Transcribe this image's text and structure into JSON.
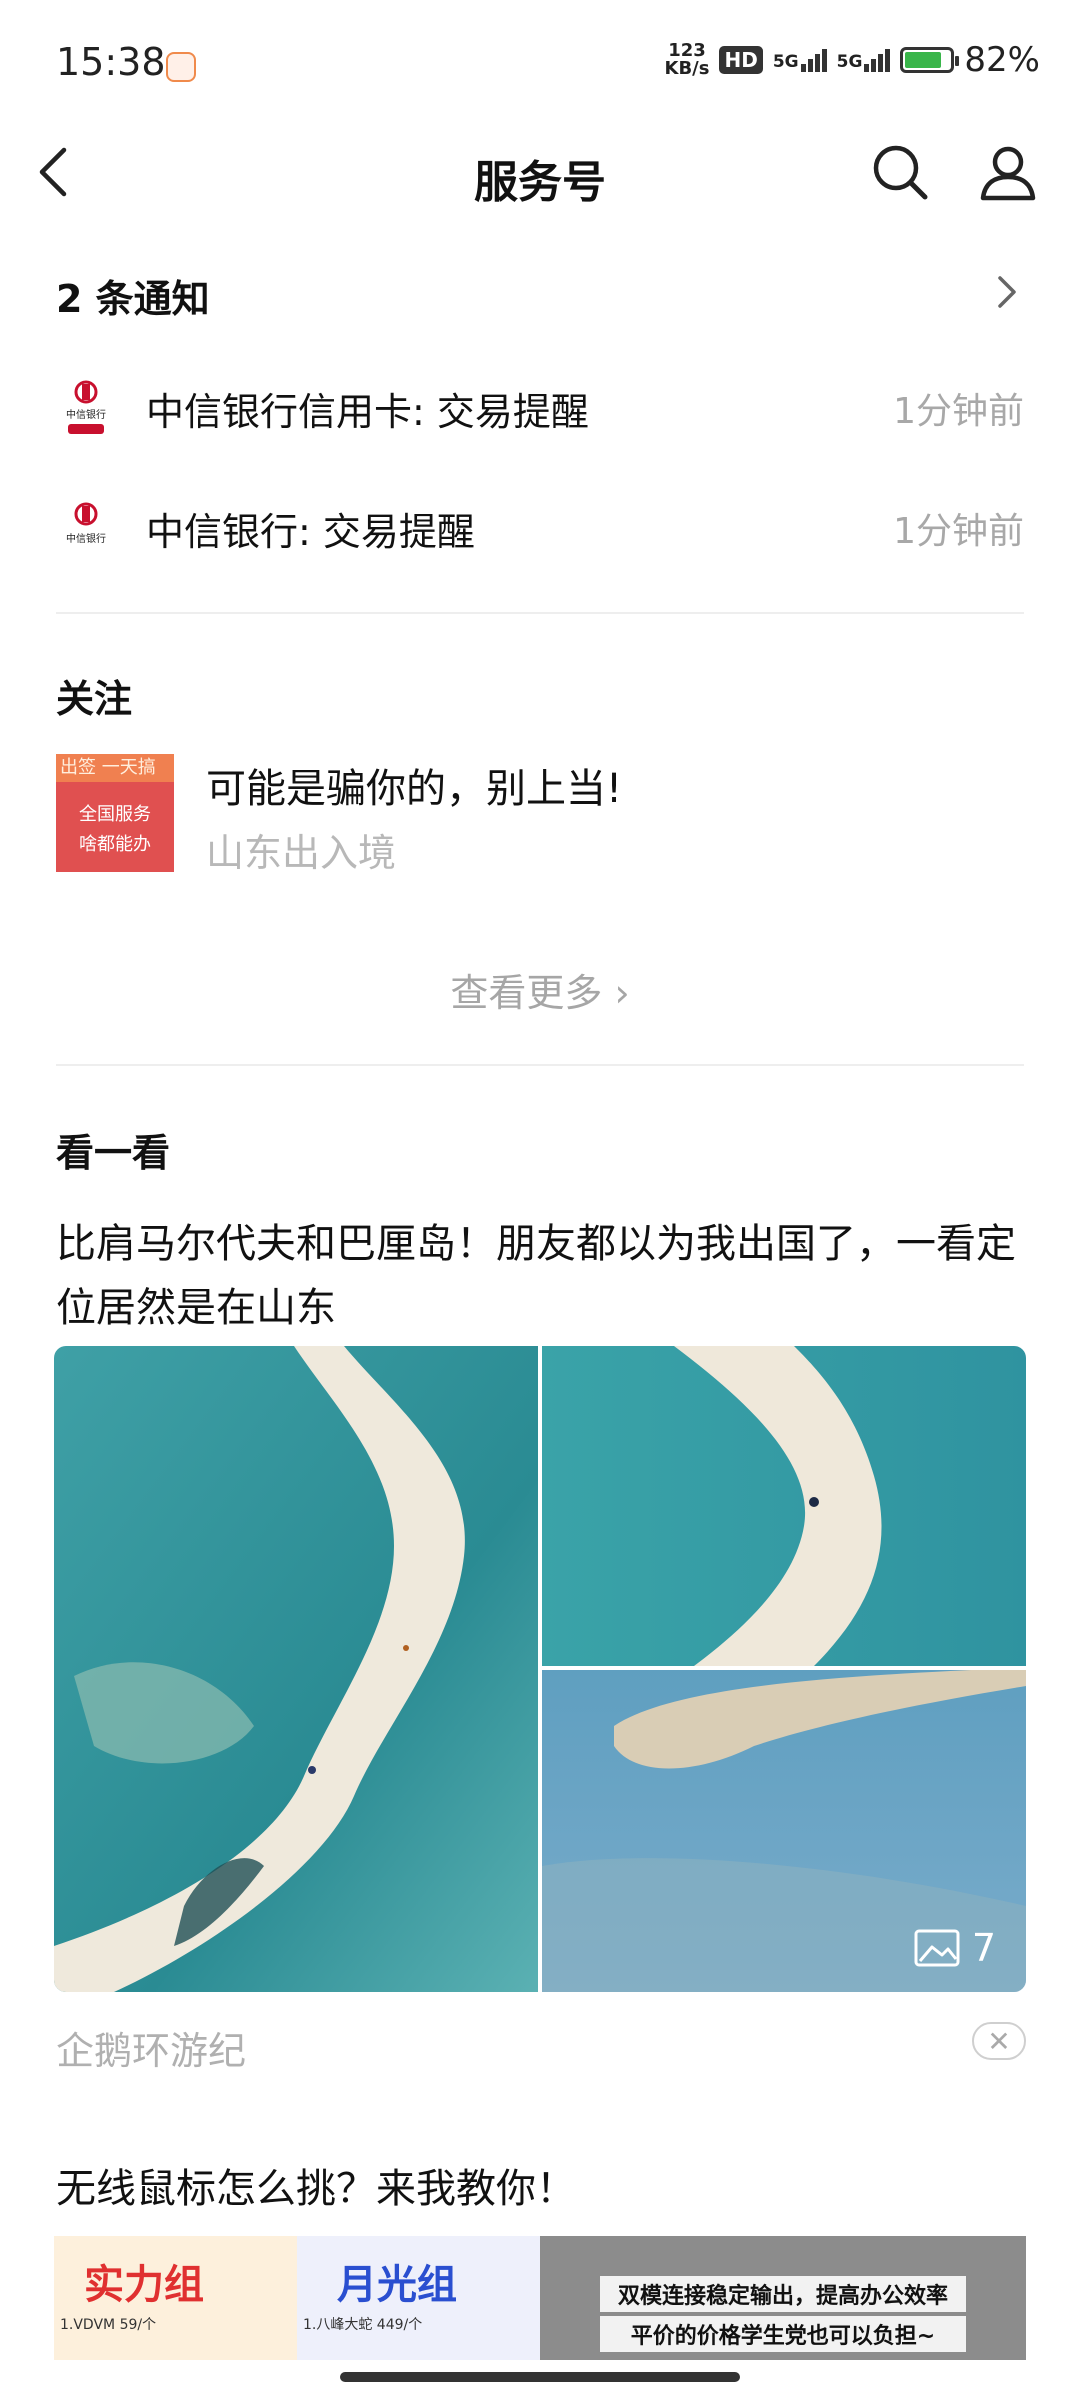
{
  "status_bar": {
    "time": "15:38",
    "net_speed_value": "123",
    "net_speed_unit": "KB/s",
    "hd_badge": "HD",
    "sim1": "5G",
    "sim2": "5G",
    "battery_pct": "82%",
    "battery_level": 0.82
  },
  "nav": {
    "title": "服务号"
  },
  "notifications": {
    "header": "2 条通知",
    "items": [
      {
        "text": "中信银行信用卡: 交易提醒",
        "time": "1分钟前",
        "logo_label": "中信银行"
      },
      {
        "text": "中信银行: 交易提醒",
        "time": "1分钟前",
        "logo_label": "中信银行"
      }
    ]
  },
  "following": {
    "header": "关注",
    "item": {
      "title": "可能是骗你的，别上当!",
      "source": "山东出入境",
      "thumb_lines": [
        "全国服务",
        "啥都能办"
      ],
      "thumb_top": "出签 一天搞"
    },
    "see_more": "查看更多 ›"
  },
  "discover": {
    "header": "看一看",
    "article1": {
      "title": "比肩马尔代夫和巴厘岛！朋友都以为我出国了，一看定位居然是在山东",
      "image_count": "7",
      "source": "企鹅环游纪",
      "close_symbol": "✕"
    },
    "article2": {
      "title": "无线鼠标怎么挑？来我教你！",
      "strip_a": "实力组",
      "strip_a_small": "1.VDVM   59/个",
      "strip_b": "月光组",
      "strip_b_small": "1.八峰大蛇   449/个",
      "strip_c_line1": "双模连接稳定输出，提高办公效率",
      "strip_c_line2": "平价的价格学生党也可以负担~"
    }
  },
  "colors": {
    "accent_red": "#e03030",
    "text_primary": "#111111",
    "text_secondary": "#a8a8a8",
    "divider": "#eeeeee"
  }
}
